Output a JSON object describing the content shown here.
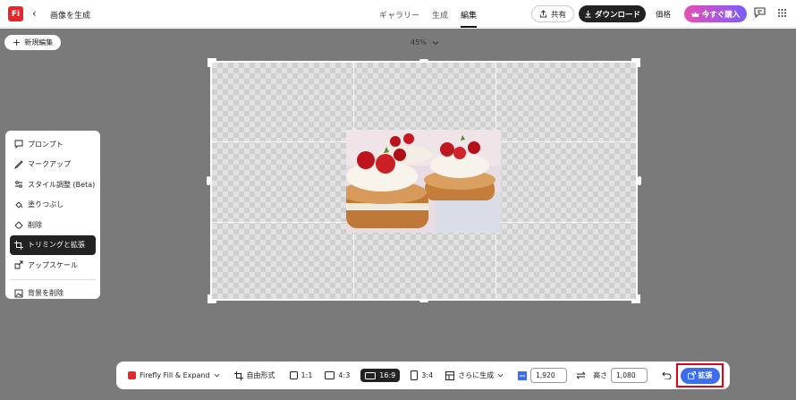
{
  "header": {
    "logo_text": "Fi",
    "back_icon": "chevron-left-icon",
    "title": "画像を生成",
    "nav": [
      "ギャラリー",
      "生成",
      "編集"
    ],
    "nav_active": "編集",
    "share_label": "共有",
    "download_label": "ダウンロード",
    "price_label": "価格",
    "buy_label": "今すぐ購入"
  },
  "canvas": {
    "new_edit_label": "新規編集",
    "zoom": "45%"
  },
  "left_panel": {
    "items": [
      {
        "label": "プロンプト",
        "icon": "prompt-icon"
      },
      {
        "label": "マークアップ",
        "icon": "markup-icon"
      },
      {
        "label": "スタイル調整 (Beta)",
        "icon": "style-adjust-icon"
      },
      {
        "label": "塗りつぶし",
        "icon": "fill-icon"
      },
      {
        "label": "削除",
        "icon": "erase-icon"
      },
      {
        "label": "トリミングと拡張",
        "icon": "crop-icon",
        "active": true
      },
      {
        "label": "アップスケール",
        "icon": "upscale-icon"
      },
      {
        "label": "背景を削除",
        "icon": "remove-background-icon"
      }
    ]
  },
  "toolbar": {
    "model_label": "Firefly Fill & Expand",
    "freeform_label": "自由形式",
    "ratio_1_1": "1:1",
    "ratio_4_3": "4:3",
    "ratio_16_9": "16:9",
    "ratio_3_4": "3:4",
    "more_label": "さらに生成",
    "width_value": "1,920",
    "height_label": "高さ",
    "height_value": "1,080",
    "expand_label": "拡張"
  },
  "colors": {
    "accent": "#3c6cf0",
    "highlight": "#e0001a",
    "logo": "#e8262a"
  }
}
